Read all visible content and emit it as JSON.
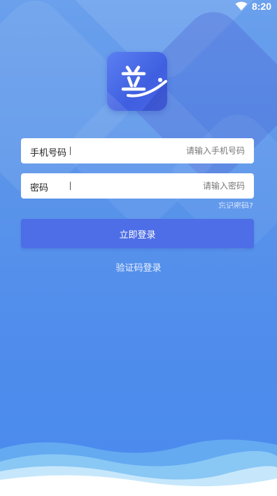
{
  "status_bar": {
    "time": "8:20",
    "wifi_icon": "wifi-icon"
  },
  "app": {
    "logo_icon": "app-logo-icon"
  },
  "form": {
    "phone": {
      "label": "手机号码",
      "placeholder": "请输入手机号码",
      "value": ""
    },
    "password": {
      "label": "密码",
      "placeholder": "请输入密码",
      "value": ""
    },
    "forgot_password": "忘记密码?",
    "login_button": "立即登录",
    "sms_login": "验证码登录"
  },
  "colors": {
    "background_top": "#6aa0ec",
    "background_bottom": "#4a8bee",
    "primary_button": "#4d6ee6",
    "logo_background": "#4a66e8"
  }
}
